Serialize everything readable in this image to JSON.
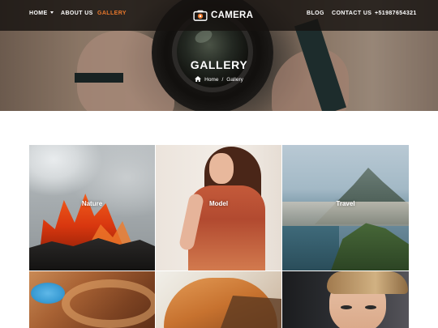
{
  "nav": {
    "left": [
      {
        "label": "HOME",
        "has_dropdown": true
      },
      {
        "label": "ABOUT US"
      },
      {
        "label": "GALLERY",
        "active": true
      }
    ],
    "right": [
      {
        "label": "BLOG"
      },
      {
        "label": "CONTACT US"
      },
      {
        "label": "+51987654321"
      }
    ],
    "logo_text": "CAMERA",
    "logo_icon": "camera-icon"
  },
  "hero": {
    "title": "GALLERY",
    "breadcrumb": {
      "home_icon": "home-icon",
      "home": "Home",
      "separator": "/",
      "current": "Gallery"
    }
  },
  "gallery": {
    "tiles": [
      {
        "label": "Nature"
      },
      {
        "label": "Model"
      },
      {
        "label": "Travel"
      },
      {
        "label": ""
      },
      {
        "label": ""
      },
      {
        "label": ""
      }
    ]
  },
  "colors": {
    "accent": "#e8782c",
    "nav_bg": "#161210",
    "text_light": "#ffffff"
  }
}
